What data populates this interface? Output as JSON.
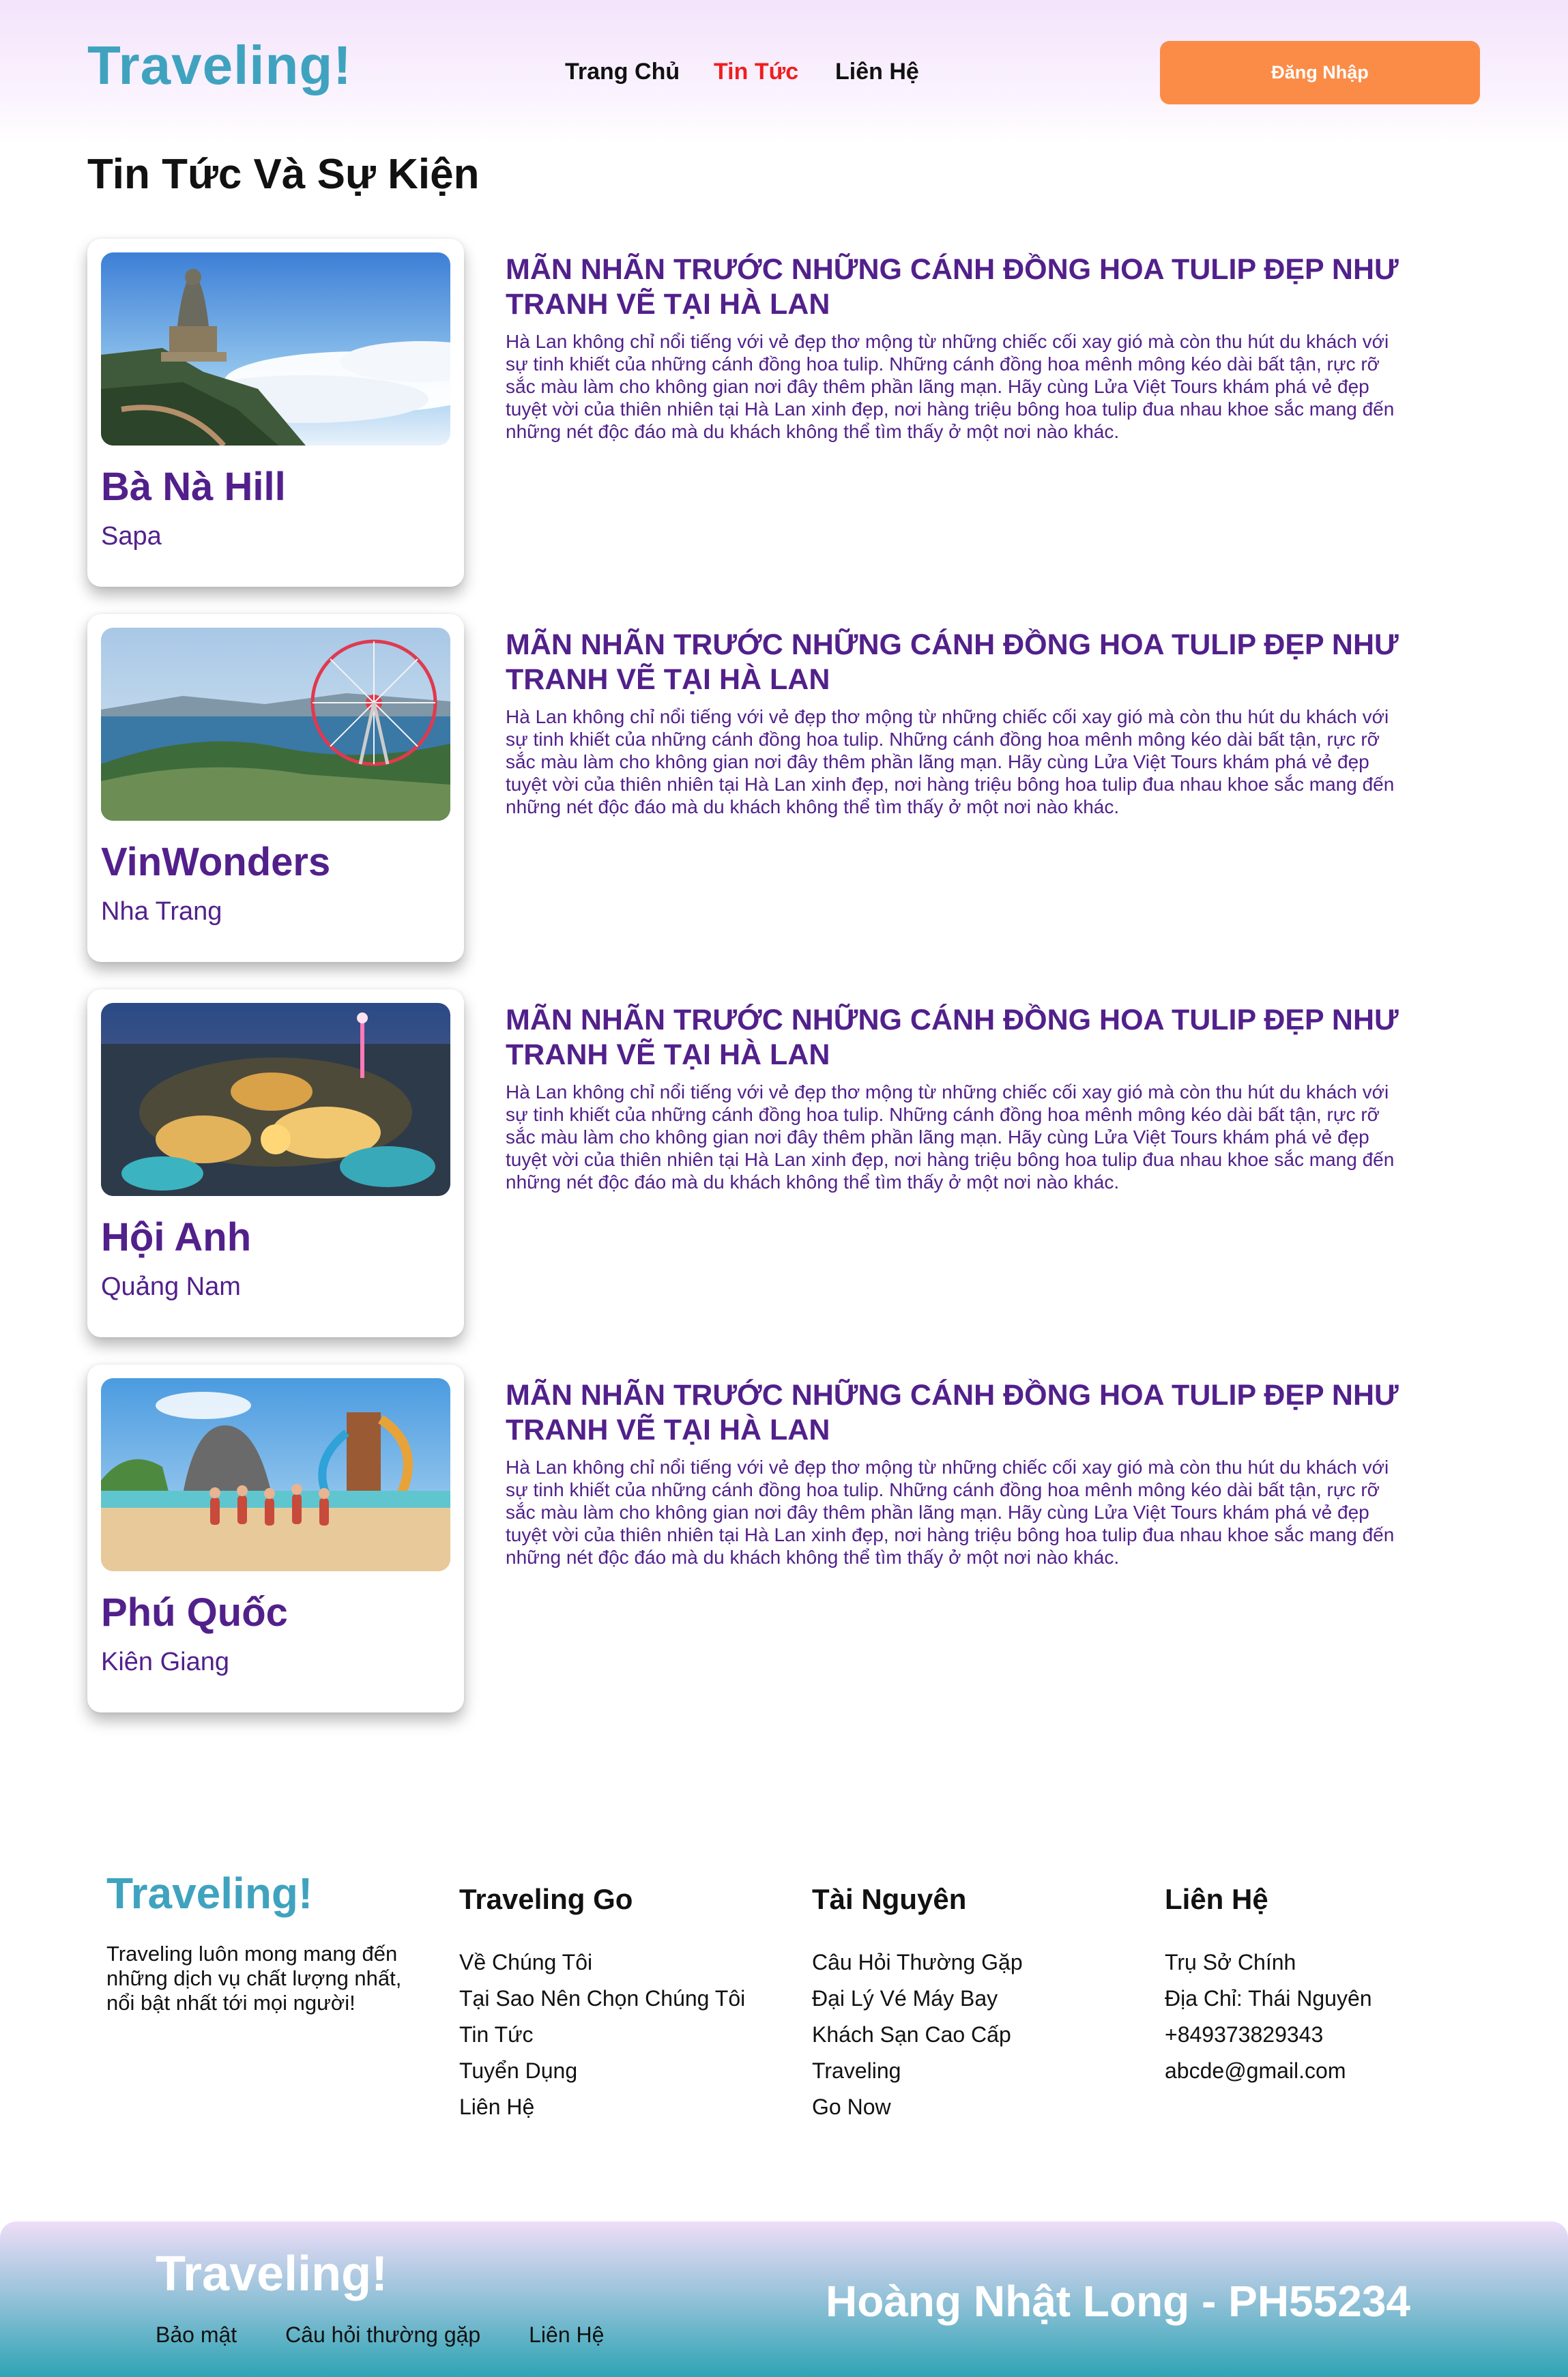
{
  "header": {
    "logo": "Traveling!",
    "nav": {
      "home": "Trang Chủ",
      "news": "Tin Tức",
      "contact": "Liên Hệ"
    },
    "login_label": "Đăng Nhập"
  },
  "page_title": "Tin Tức Và Sự Kiện",
  "news": [
    {
      "place": "Bà Nà Hill",
      "region": "Sapa",
      "title": "MÃN NHÃN TRƯỚC NHỮNG CÁNH ĐỒNG HOA TULIP ĐẸP NHƯ TRANH VẼ TẠI HÀ LAN",
      "body": "Hà Lan không chỉ nổi tiếng với vẻ đẹp thơ mộng từ những chiếc cối xay gió mà còn thu hút du khách với sự tinh khiết của những cánh đồng hoa tulip. Những cánh đồng hoa mênh mông kéo dài bất tận, rực rỡ sắc màu làm cho không gian nơi đây thêm phần lãng mạn. Hãy cùng Lửa Việt Tours khám phá vẻ đẹp tuyệt vời của thiên nhiên tại Hà Lan xinh đẹp, nơi hàng triệu bông hoa tulip đua nhau khoe sắc mang đến những nét độc đáo mà du khách không thể tìm thấy ở một nơi nào khác."
    },
    {
      "place": "VinWonders",
      "region": "Nha Trang",
      "title": "MÃN NHÃN TRƯỚC NHỮNG CÁNH ĐỒNG HOA TULIP ĐẸP NHƯ TRANH VẼ TẠI HÀ LAN",
      "body": "Hà Lan không chỉ nổi tiếng với vẻ đẹp thơ mộng từ những chiếc cối xay gió mà còn thu hút du khách với sự tinh khiết của những cánh đồng hoa tulip. Những cánh đồng hoa mênh mông kéo dài bất tận, rực rỡ sắc màu làm cho không gian nơi đây thêm phần lãng mạn. Hãy cùng Lửa Việt Tours khám phá vẻ đẹp tuyệt vời của thiên nhiên tại Hà Lan xinh đẹp, nơi hàng triệu bông hoa tulip đua nhau khoe sắc mang đến những nét độc đáo mà du khách không thể tìm thấy ở một nơi nào khác."
    },
    {
      "place": "Hội Anh",
      "region": "Quảng Nam",
      "title": "MÃN NHÃN TRƯỚC NHỮNG CÁNH ĐỒNG HOA TULIP ĐẸP NHƯ TRANH VẼ TẠI HÀ LAN",
      "body": "Hà Lan không chỉ nổi tiếng với vẻ đẹp thơ mộng từ những chiếc cối xay gió mà còn thu hút du khách với sự tinh khiết của những cánh đồng hoa tulip. Những cánh đồng hoa mênh mông kéo dài bất tận, rực rỡ sắc màu làm cho không gian nơi đây thêm phần lãng mạn. Hãy cùng Lửa Việt Tours khám phá vẻ đẹp tuyệt vời của thiên nhiên tại Hà Lan xinh đẹp, nơi hàng triệu bông hoa tulip đua nhau khoe sắc mang đến những nét độc đáo mà du khách không thể tìm thấy ở một nơi nào khác."
    },
    {
      "place": "Phú Quốc",
      "region": "Kiên Giang",
      "title": "MÃN NHÃN TRƯỚC NHỮNG CÁNH ĐỒNG HOA TULIP ĐẸP NHƯ TRANH VẼ TẠI HÀ LAN",
      "body": "Hà Lan không chỉ nổi tiếng với vẻ đẹp thơ mộng từ những chiếc cối xay gió mà còn thu hút du khách với sự tinh khiết của những cánh đồng hoa tulip. Những cánh đồng hoa mênh mông kéo dài bất tận, rực rỡ sắc màu làm cho không gian nơi đây thêm phần lãng mạn. Hãy cùng Lửa Việt Tours khám phá vẻ đẹp tuyệt vời của thiên nhiên tại Hà Lan xinh đẹp, nơi hàng triệu bông hoa tulip đua nhau khoe sắc mang đến những nét độc đáo mà du khách không thể tìm thấy ở một nơi nào khác."
    }
  ],
  "footer": {
    "logo": "Traveling!",
    "description": "Traveling luôn mong mang đến những dịch vụ chất lượng nhất, nổi bật nhất tới mọi người!",
    "columns": [
      {
        "heading": "Traveling Go",
        "links": [
          "Về Chúng Tôi",
          "Tại Sao Nên Chọn Chúng Tôi",
          "Tin Tức",
          "Tuyển Dụng",
          "Liên Hệ"
        ]
      },
      {
        "heading": "Tài Nguyên",
        "links": [
          "Câu Hỏi Thường Gặp",
          "Đại Lý Vé Máy Bay",
          "Khách Sạn Cao Cấp",
          "Traveling",
          "Go Now"
        ]
      },
      {
        "heading": "Liên Hệ",
        "links": [
          "Trụ Sở Chính",
          "Địa Chỉ: Thái Nguyên",
          "+849373829343",
          "abcde@gmail.com"
        ]
      }
    ]
  },
  "bottom_bar": {
    "logo": "Traveling!",
    "links": [
      "Bảo mật",
      "Câu hỏi thường gặp",
      "Liên Hệ"
    ],
    "author": "Hoàng Nhật Long - PH55234"
  },
  "colors": {
    "brand_teal": "#3fa3bf",
    "accent_orange": "#fb8c47",
    "active_nav_red": "#f01e1e",
    "news_purple": "#52208b"
  }
}
